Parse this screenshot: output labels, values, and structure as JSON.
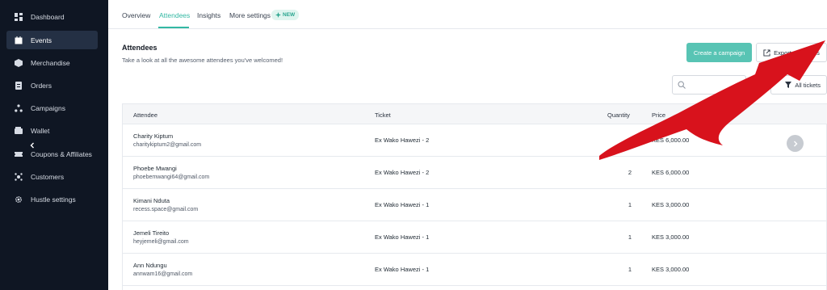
{
  "sidebar": {
    "items": [
      {
        "label": "Dashboard",
        "icon": "dashboard-icon",
        "active": false
      },
      {
        "label": "Events",
        "icon": "events-icon",
        "active": true
      },
      {
        "label": "Merchandise",
        "icon": "merchandise-icon",
        "active": false
      },
      {
        "label": "Orders",
        "icon": "orders-icon",
        "active": false
      },
      {
        "label": "Campaigns",
        "icon": "campaigns-icon",
        "active": false
      },
      {
        "label": "Wallet",
        "icon": "wallet-icon",
        "active": false
      },
      {
        "label": "Coupons & Affiliates",
        "icon": "coupons-icon",
        "active": false
      },
      {
        "label": "Customers",
        "icon": "customers-icon",
        "active": false
      },
      {
        "label": "Hustle settings",
        "icon": "settings-icon",
        "active": false
      }
    ]
  },
  "tabs": {
    "items": [
      {
        "label": "Overview",
        "active": false
      },
      {
        "label": "Attendees",
        "active": true
      },
      {
        "label": "Insights",
        "active": false
      },
      {
        "label": "More settings",
        "active": false
      }
    ],
    "new_badge": "NEW"
  },
  "header": {
    "title": "Attendees",
    "subtitle": "Take a look at all the awesome attendees you've welcomed!",
    "create_campaign_label": "Create a campaign",
    "export_label": "Export attendees",
    "filter_label": "All tickets"
  },
  "table": {
    "columns": [
      "Attendee",
      "Ticket",
      "Quantity",
      "Price"
    ],
    "rows": [
      {
        "name": "Charity Kiptum",
        "email": "charitykiptum2@gmail.com",
        "ticket": "Ex Wako Hawezi - 2",
        "quantity": "",
        "price": "KES 6,000.00"
      },
      {
        "name": "Phoebe Mwangi",
        "email": "phoebemwangi64@gmail.com",
        "ticket": "Ex Wako Hawezi - 2",
        "quantity": "2",
        "price": "KES 6,000.00"
      },
      {
        "name": "Kimani Nduta",
        "email": "recess.space@gmail.com",
        "ticket": "Ex Wako Hawezi - 1",
        "quantity": "1",
        "price": "KES 3,000.00"
      },
      {
        "name": "Jemeli Tireito",
        "email": "heyjemeli@gmail.com",
        "ticket": "Ex Wako Hawezi - 1",
        "quantity": "1",
        "price": "KES 3,000.00"
      },
      {
        "name": "Ann Ndungu",
        "email": "annwam16@gmail.com",
        "ticket": "Ex Wako Hawezi - 1",
        "quantity": "1",
        "price": "KES 3,000.00"
      }
    ]
  },
  "colors": {
    "sidebar_bg": "#0f1623",
    "accent": "#33b8a3",
    "button_primary": "#58c4b4",
    "annotation_arrow": "#d8121c"
  }
}
